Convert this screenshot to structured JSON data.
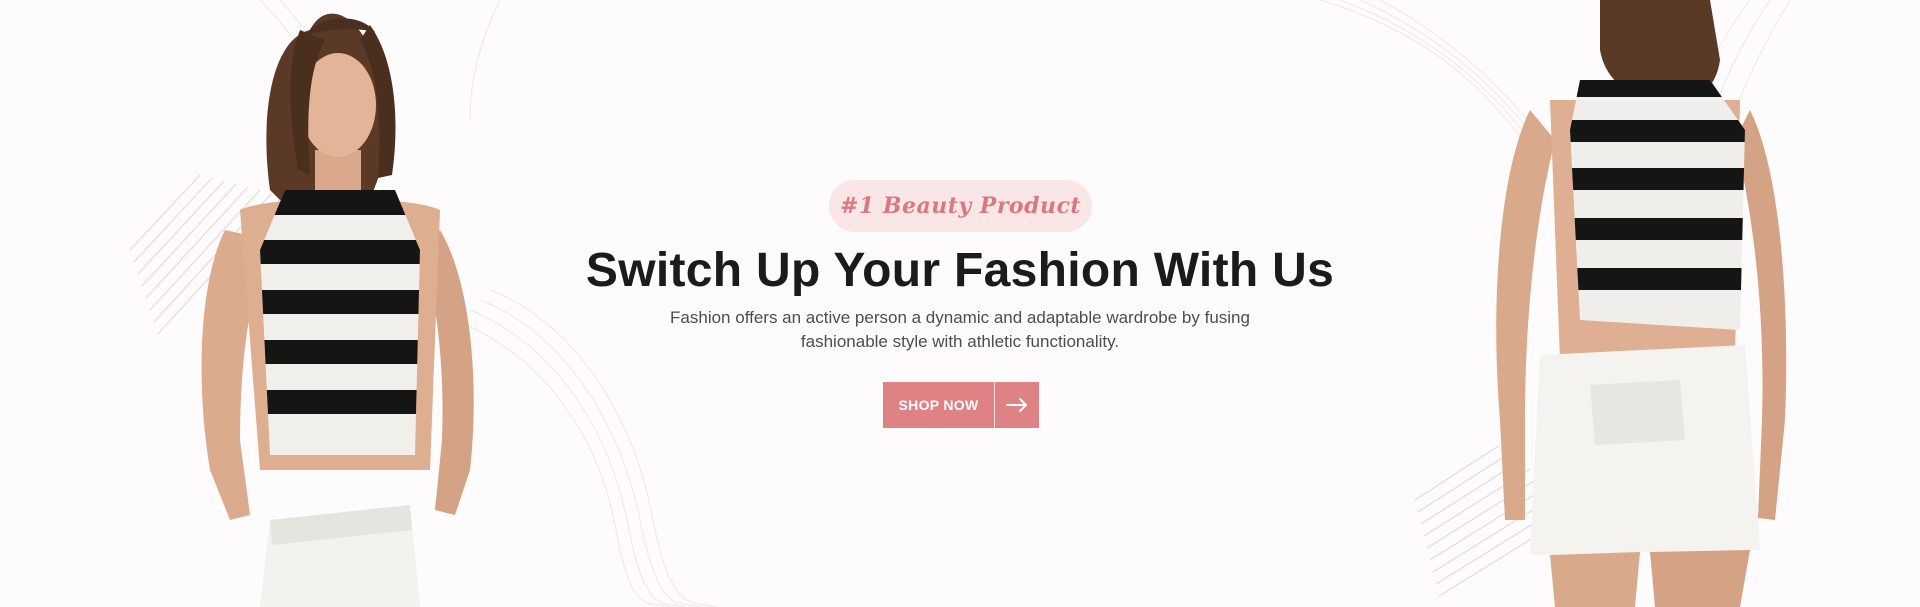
{
  "hero": {
    "badge": "#1 Beauty Product",
    "title": "Switch Up Your Fashion With Us",
    "subtitle_line1": "Fashion offers an active person a dynamic and adaptable wardrobe by fusing",
    "subtitle_line2": "fashionable style with athletic functionality.",
    "cta_label": "SHOP NOW",
    "cta_icon": "arrow-right-icon"
  },
  "colors": {
    "accent": "#df8285",
    "badge_bg": "#fae6e6",
    "badge_text": "#d9787e",
    "heading": "#1b1b1b",
    "body_text": "#4d4d4d",
    "background": "#fdfbfb"
  }
}
